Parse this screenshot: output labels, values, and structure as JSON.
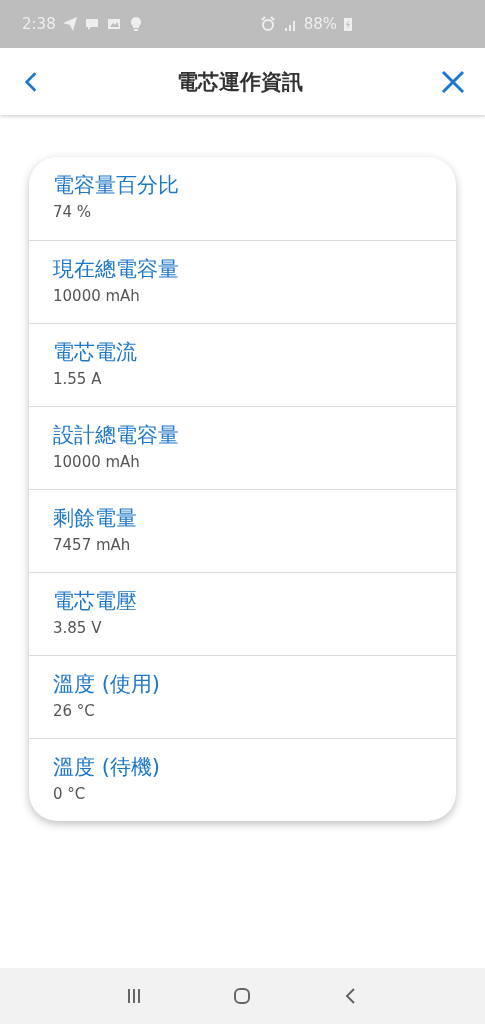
{
  "status_bar": {
    "time": "2:38",
    "battery": "88%"
  },
  "header": {
    "title": "電芯運作資訊"
  },
  "items": [
    {
      "label": "電容量百分比",
      "value": "74 %"
    },
    {
      "label": "現在總電容量",
      "value": "10000 mAh"
    },
    {
      "label": "電芯電流",
      "value": "1.55 A"
    },
    {
      "label": "設計總電容量",
      "value": "10000 mAh"
    },
    {
      "label": "剩餘電量",
      "value": "7457 mAh"
    },
    {
      "label": "電芯電壓",
      "value": "3.85 V"
    },
    {
      "label": "溫度 (使用)",
      "value": "26 °C"
    },
    {
      "label": "溫度 (待機)",
      "value": "0 °C"
    }
  ]
}
